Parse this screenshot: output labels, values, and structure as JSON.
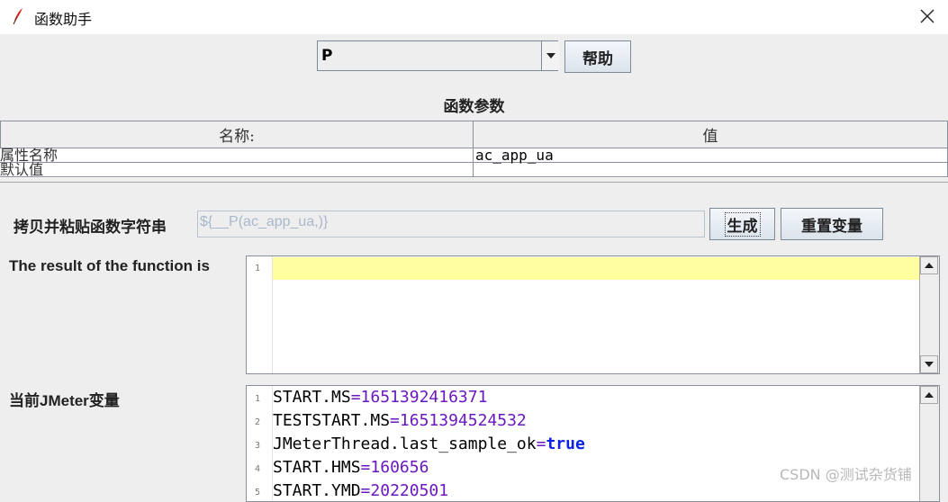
{
  "window": {
    "title": "函数助手"
  },
  "function_select": {
    "value": "P"
  },
  "help_button": "帮助",
  "params": {
    "title": "函数参数",
    "columns": [
      "名称:",
      "值"
    ],
    "rows": [
      {
        "name": "属性名称",
        "value": "ac_app_ua"
      },
      {
        "name": "默认值",
        "value": ""
      }
    ]
  },
  "copy": {
    "label": "拷贝并粘贴函数字符串",
    "value": "${__P(ac_app_ua,)}",
    "generate_button": "生成",
    "reset_button": "重置变量"
  },
  "result": {
    "label": "The result of the function is",
    "line_numbers": [
      "1"
    ],
    "text": ""
  },
  "variables": {
    "label": "当前JMeter变量",
    "lines": [
      {
        "n": "1",
        "key": "START.MS",
        "value": "1651392416371",
        "type": "num"
      },
      {
        "n": "2",
        "key": "TESTSTART.MS",
        "value": "1651394524532",
        "type": "num"
      },
      {
        "n": "3",
        "key": "JMeterThread.last_sample_ok",
        "value": "true",
        "type": "bool"
      },
      {
        "n": "4",
        "key": "START.HMS",
        "value": "160656",
        "type": "num"
      },
      {
        "n": "5",
        "key": "START.YMD",
        "value": "20220501",
        "type": "num"
      }
    ]
  },
  "watermark": "CSDN @测试杂货铺",
  "icons": {
    "app": "feather-icon",
    "close": "close-icon",
    "combo": "chevron-down-icon",
    "scroll_up": "arrow-up-icon",
    "scroll_down": "arrow-down-icon"
  }
}
